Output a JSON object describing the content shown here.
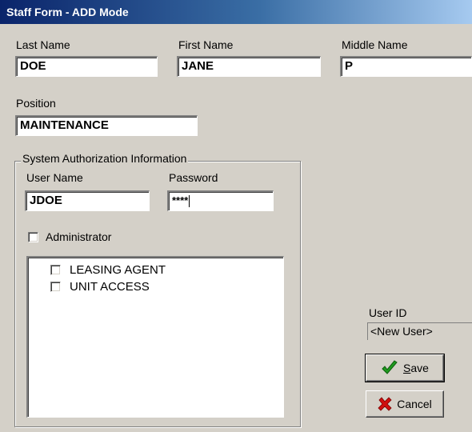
{
  "window": {
    "title": "Staff Form - ADD Mode"
  },
  "name": {
    "last_label": "Last Name",
    "last_value": "DOE",
    "first_label": "First Name",
    "first_value": "JANE",
    "middle_label": "Middle Name",
    "middle_value": "P"
  },
  "position": {
    "label": "Position",
    "value": "MAINTENANCE"
  },
  "auth": {
    "group_title": "System Authorization Information",
    "user_label": "User Name",
    "user_value": "JDOE",
    "password_label": "Password",
    "password_value": "****",
    "admin_label": "Administrator",
    "admin_checked": false,
    "roles": [
      {
        "label": "LEASING AGENT",
        "checked": false
      },
      {
        "label": "UNIT ACCESS",
        "checked": false
      }
    ]
  },
  "userid": {
    "label": "User ID",
    "value": "<New User>"
  },
  "buttons": {
    "save_label": "ave",
    "save_mnemonic": "S",
    "cancel_label": "Cancel",
    "save_icon": "green-checkmark-icon",
    "cancel_icon": "red-x-icon",
    "save_icon_color": "#1f9a1f",
    "cancel_icon_color": "#d01010"
  }
}
